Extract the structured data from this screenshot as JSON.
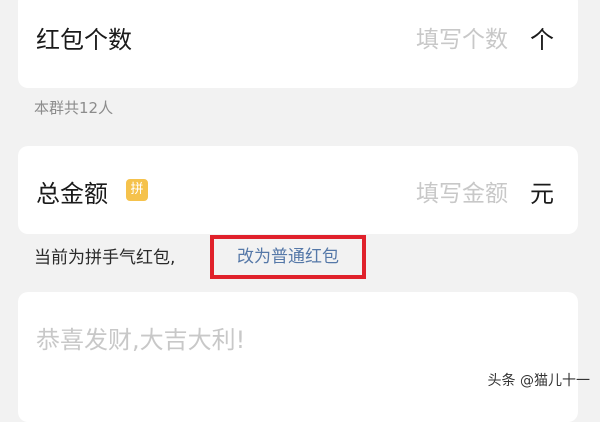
{
  "packet_count": {
    "label": "红包个数",
    "placeholder": "填写个数",
    "unit": "个"
  },
  "group_note": "本群共12人",
  "total_amount": {
    "label": "总金额",
    "badge": "拼",
    "badge_color": "#f5c24c",
    "placeholder": "填写金额",
    "unit": "元"
  },
  "packet_type": {
    "current_text": "当前为拼手气红包,",
    "switch_link": "改为普通红包",
    "link_color": "#5578a8",
    "highlight_color": "#e0212b"
  },
  "greeting": {
    "placeholder": "恭喜发财,大吉大利!"
  },
  "watermark": "头条 @猫儿十一"
}
